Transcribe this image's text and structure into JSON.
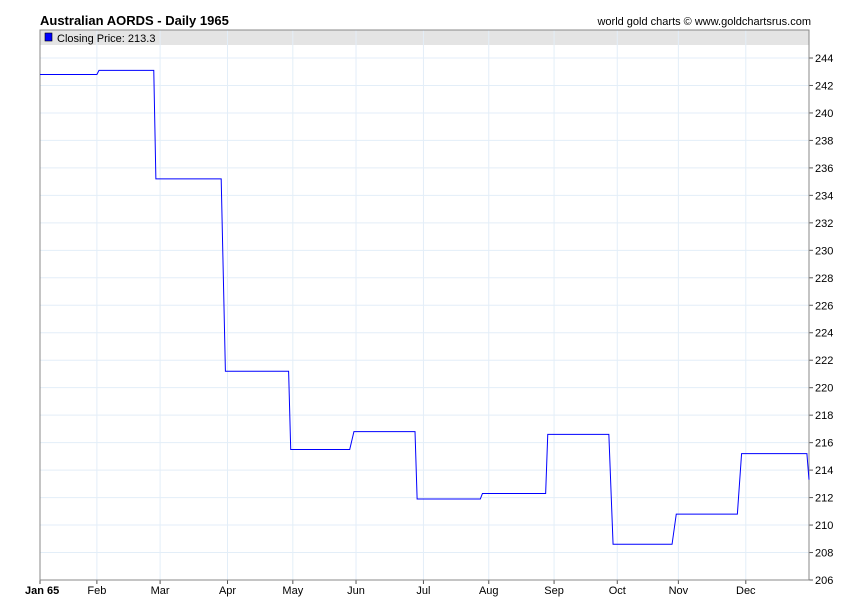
{
  "header": {
    "title": "Australian AORDS - Daily 1965",
    "credit": "world gold charts © www.goldchartsrus.com"
  },
  "chart_data": {
    "type": "line",
    "title": "Australian AORDS - Daily 1965",
    "legend": {
      "label": "Closing Price: 213.3",
      "color": "#0000ff",
      "placement": "top-left"
    },
    "xlabel": "",
    "ylabel": "",
    "x_unit": "day of year 1965",
    "xlim": [
      0,
      365
    ],
    "ylim": [
      206,
      245.5
    ],
    "yticks": [
      206,
      208,
      210,
      212,
      214,
      216,
      218,
      220,
      222,
      224,
      226,
      228,
      230,
      232,
      234,
      236,
      238,
      240,
      242,
      244
    ],
    "xticks": [
      {
        "label": "Jan 65",
        "day": 0,
        "bold": true
      },
      {
        "label": "Feb",
        "day": 27
      },
      {
        "label": "Mar",
        "day": 57
      },
      {
        "label": "Apr",
        "day": 89
      },
      {
        "label": "May",
        "day": 120
      },
      {
        "label": "Jun",
        "day": 150
      },
      {
        "label": "Jul",
        "day": 182
      },
      {
        "label": "Aug",
        "day": 213
      },
      {
        "label": "Sep",
        "day": 244
      },
      {
        "label": "Oct",
        "day": 274
      },
      {
        "label": "Nov",
        "day": 303
      },
      {
        "label": "Dec",
        "day": 335
      }
    ],
    "grid": true,
    "series": [
      {
        "name": "Closing Price",
        "color": "#0000ff",
        "points": [
          [
            0,
            242.8
          ],
          [
            27,
            242.8
          ],
          [
            28,
            243.1
          ],
          [
            54,
            243.1
          ],
          [
            55,
            235.2
          ],
          [
            86,
            235.2
          ],
          [
            88,
            221.2
          ],
          [
            118,
            221.2
          ],
          [
            119,
            215.5
          ],
          [
            147,
            215.5
          ],
          [
            149,
            216.8
          ],
          [
            178,
            216.8
          ],
          [
            179,
            211.9
          ],
          [
            209,
            211.9
          ],
          [
            210,
            212.3
          ],
          [
            240,
            212.3
          ],
          [
            241,
            216.6
          ],
          [
            270,
            216.6
          ],
          [
            272,
            208.6
          ],
          [
            300,
            208.6
          ],
          [
            302,
            210.8
          ],
          [
            331,
            210.8
          ],
          [
            333,
            215.2
          ],
          [
            364,
            215.2
          ],
          [
            365,
            213.3
          ]
        ]
      }
    ]
  }
}
